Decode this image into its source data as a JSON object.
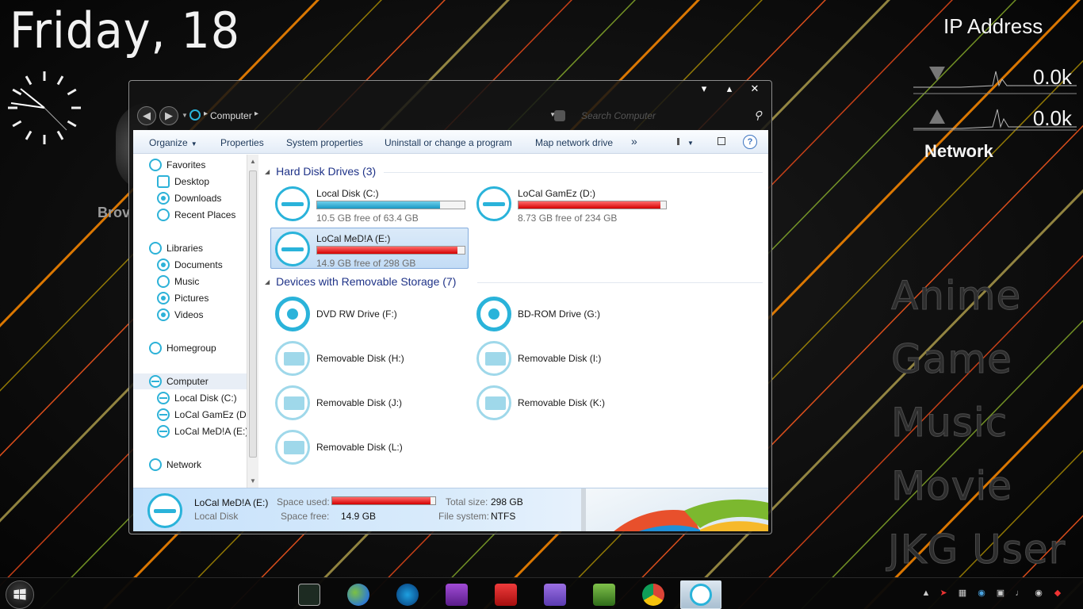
{
  "desktop": {
    "date_text": "Friday, 18",
    "browser_partial": "Brov",
    "network_gadget": {
      "title": "IP Address",
      "download_value": "0.0k",
      "upload_value": "0.0k",
      "label": "Network"
    },
    "shortcuts": [
      "Anime",
      "Game",
      "Music",
      "Movie",
      "JKG User"
    ]
  },
  "window": {
    "controls": {
      "minimize": "▾",
      "maximize": "▴",
      "close": "✕"
    },
    "address": {
      "crumb": "Computer"
    },
    "search": {
      "placeholder": "Search Computer"
    },
    "toolbar": {
      "organize": "Organize",
      "properties": "Properties",
      "system_properties": "System properties",
      "uninstall": "Uninstall or change a program",
      "map_drive": "Map network drive",
      "more": "»",
      "help": "?"
    },
    "nav": {
      "favorites": "Favorites",
      "desktop": "Desktop",
      "downloads": "Downloads",
      "recent_places": "Recent Places",
      "libraries": "Libraries",
      "documents": "Documents",
      "music": "Music",
      "pictures": "Pictures",
      "videos": "Videos",
      "homegroup": "Homegroup",
      "computer": "Computer",
      "drive_c": "Local Disk (C:)",
      "drive_d": "LoCal GamEz (D:)",
      "drive_e": "LoCal MeD!A (E:)",
      "network": "Network"
    },
    "groups": {
      "hard_disks": "Hard Disk Drives (3)",
      "removable": "Devices with Removable Storage (7)"
    },
    "hard_drives": [
      {
        "name": "Local Disk (C:)",
        "free": "10.5 GB free of 63.4 GB",
        "used_fraction": 0.834
      },
      {
        "name": "LoCal GamEz (D:)",
        "free": "8.73 GB free of 234 GB",
        "used_fraction": 0.963
      },
      {
        "name": "LoCal MeD!A (E:)",
        "free": "14.9 GB free of 298 GB",
        "used_fraction": 0.95
      }
    ],
    "devices": [
      "DVD RW Drive (F:)",
      "BD-ROM Drive (G:)",
      "Removable Disk (H:)",
      "Removable Disk (I:)",
      "Removable Disk (J:)",
      "Removable Disk (K:)",
      "Removable Disk (L:)"
    ],
    "details": {
      "name": "LoCal MeD!A (E:)",
      "type": "Local Disk",
      "space_used_label": "Space used:",
      "space_free_label": "Space free:",
      "space_free_value": "14.9 GB",
      "total_size_label": "Total size:",
      "total_size_value": "298 GB",
      "file_system_label": "File system:",
      "file_system_value": "NTFS",
      "used_fraction": 0.95
    }
  },
  "taskbar": {
    "apps": [
      "resource-monitor",
      "messenger",
      "media-player",
      "px-player",
      "flash",
      "cpu-z",
      "gpu-tool",
      "chrome",
      "explorer"
    ],
    "colors": {
      "accent": "#2ab3da",
      "warning": "#d40000"
    }
  }
}
